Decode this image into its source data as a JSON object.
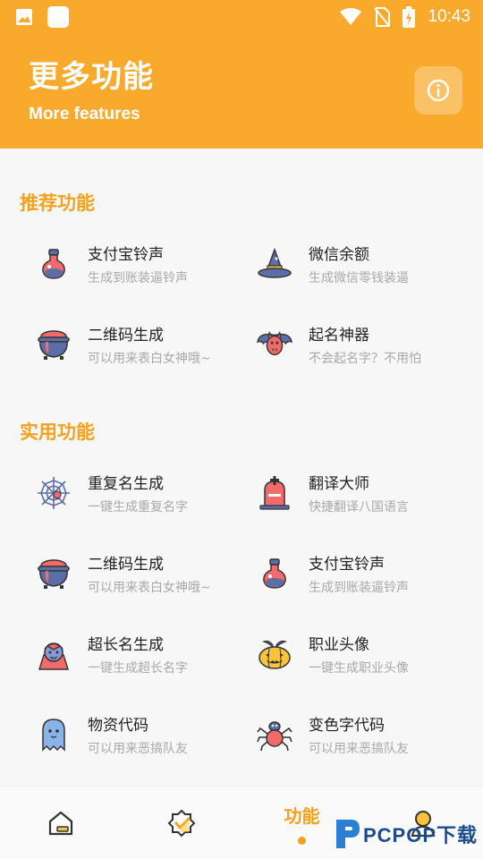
{
  "status_bar": {
    "time": "10:43",
    "icons": [
      "image-icon",
      "square-icon",
      "wifi-icon",
      "no-sim-icon",
      "battery-charging-icon"
    ]
  },
  "header": {
    "title": "更多功能",
    "subtitle": "More features",
    "info_icon": "info-icon"
  },
  "recommended": {
    "title": "推荐功能",
    "items": [
      {
        "name": "支付宝铃声",
        "desc": "生成到账装逼铃声",
        "icon": "potion-icon"
      },
      {
        "name": "微信余额",
        "desc": "生成微信零钱装逼",
        "icon": "witch-hat-icon"
      },
      {
        "name": "二维码生成",
        "desc": "可以用来表白女神哦~",
        "icon": "cauldron-icon"
      },
      {
        "name": "起名神器",
        "desc": "不会起名字？不用怕",
        "icon": "bat-icon"
      }
    ]
  },
  "practical": {
    "title": "实用功能",
    "items": [
      {
        "name": "重复名生成",
        "desc": "一键生成重复名字",
        "icon": "spiderweb-icon"
      },
      {
        "name": "翻译大师",
        "desc": "快捷翻译八国语言",
        "icon": "tombstone-icon"
      },
      {
        "name": "二维码生成",
        "desc": "可以用来表白女神哦~",
        "icon": "cauldron-icon"
      },
      {
        "name": "支付宝铃声",
        "desc": "生成到账装逼铃声",
        "icon": "potion-icon"
      },
      {
        "name": "超长名生成",
        "desc": "一键生成超长名字",
        "icon": "vampire-icon"
      },
      {
        "name": "职业头像",
        "desc": "一键生成职业头像",
        "icon": "pumpkin-icon"
      },
      {
        "name": "物资代码",
        "desc": "可以用来恶搞队友",
        "icon": "ghost-icon"
      },
      {
        "name": "变色字代码",
        "desc": "可以用来恶搞队友",
        "icon": "spider-icon"
      }
    ]
  },
  "bottom_nav": {
    "items": [
      {
        "icon": "home-icon"
      },
      {
        "icon": "badge-check-icon"
      },
      {
        "label": "功能",
        "active": true
      },
      {
        "icon": "profile-icon"
      }
    ]
  },
  "watermark": {
    "text": "PCPOP下载",
    "small": "PCPOP Download"
  },
  "colors": {
    "accent": "#f9aa2c",
    "accent_text": "#f4a21e",
    "desc": "#a8a8a8"
  }
}
